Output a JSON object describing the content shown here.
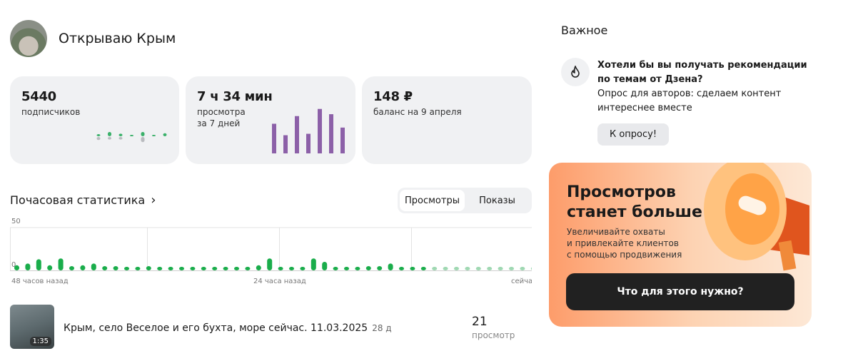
{
  "channel": {
    "name": "Открываю Крым"
  },
  "cards": [
    {
      "value": "5440",
      "label": "подписчиков",
      "spark": [
        0.5,
        1,
        0.6,
        0.2,
        1,
        0.2,
        0.7
      ],
      "spark_neg": [
        0.7,
        0.6,
        0.6,
        0,
        1.2,
        0,
        0
      ]
    },
    {
      "value": "7 ч 34 мин",
      "label1": "просмотра",
      "label2": "за 7 дней",
      "bars": [
        0.62,
        0.38,
        0.78,
        0.41,
        0.93,
        0.82,
        0.54
      ]
    },
    {
      "value": "148 ₽",
      "label": "баланс на 9 апреля"
    }
  ],
  "hourly": {
    "title": "Почасовая статистика",
    "tabs": [
      "Просмотры",
      "Показы"
    ],
    "y_max_label": "50",
    "y_min_label": "0",
    "x_labels": [
      "48 часов назад",
      "24 часа назад",
      "сейчас"
    ],
    "values": [
      6,
      8,
      13,
      6,
      14,
      5,
      6,
      8,
      5,
      5,
      3,
      3,
      5,
      3,
      3,
      2,
      2,
      2,
      2,
      2,
      2,
      2,
      6,
      14,
      4,
      2,
      4,
      14,
      10,
      3,
      4,
      4,
      5,
      5,
      8,
      2,
      4,
      4,
      2,
      2,
      2,
      2,
      2,
      2,
      2,
      2,
      3,
      3
    ],
    "dark_count": 38,
    "color": "#1aad4b",
    "light_color": "#9fd8b2"
  },
  "video": {
    "duration": "1:35",
    "title": "Крым, село Веселое и его бухта, море сейчас. 11.03.2025",
    "age": "28 д",
    "count": "21",
    "count_label": "просмотр"
  },
  "important": {
    "title": "Важное",
    "headline": "Хотели бы вы получать рекомендации по темам от Дзена?",
    "text": "Опрос для авторов: сделаем контент интереснее вместе",
    "button": "К опросу!"
  },
  "promo": {
    "title1": "Просмотров",
    "title2": "станет больше",
    "text1": "Увеличивайте охваты",
    "text2": "и привлекайте клиентов",
    "text3": "с помощью продвижения",
    "button": "Что для этого нужно?"
  }
}
